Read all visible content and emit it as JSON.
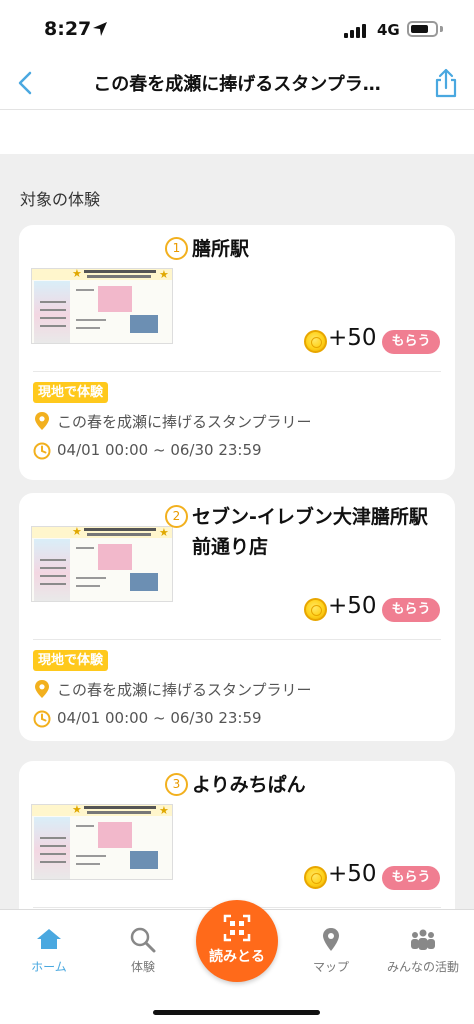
{
  "status_bar": {
    "time": "8:27",
    "network": "4G"
  },
  "nav": {
    "title": "この春を成瀬に捧げるスタンプラ…",
    "back_icon": "chevron-left-icon",
    "share_icon": "share-icon"
  },
  "section_label": "対象の体験",
  "cards": [
    {
      "number": "1",
      "title_lines": [
        "膳所駅"
      ],
      "points": "+50",
      "claim_label": "もらう",
      "tag": "現地で体験",
      "location": "この春を成瀬に捧げるスタンプラリー",
      "period": "04/01 00:00 ~ 06/30 23:59"
    },
    {
      "number": "2",
      "title_lines": [
        "セブン-イレブン大津膳所駅",
        "前通り店"
      ],
      "points": "+50",
      "claim_label": "もらう",
      "tag": "現地で体験",
      "location": "この春を成瀬に捧げるスタンプラリー",
      "period": "04/01 00:00 ~ 06/30 23:59"
    },
    {
      "number": "3",
      "title_lines": [
        "よりみちぱん"
      ],
      "points": "+50",
      "claim_label": "もらう"
    }
  ],
  "tab_bar": {
    "tabs": [
      {
        "label": "ホーム",
        "icon": "home-icon",
        "active": true
      },
      {
        "label": "体験",
        "icon": "search-icon",
        "active": false
      },
      {
        "label": "マップ",
        "icon": "map-pin-icon",
        "active": false
      },
      {
        "label": "みんなの活動",
        "icon": "people-icon",
        "active": false
      }
    ],
    "center_button": {
      "label": "読みとる",
      "icon": "qr-scan-icon"
    }
  },
  "colors": {
    "accent_blue": "#4aa8e0",
    "scan_orange": "#ff6a1a",
    "tag_yellow": "#ffc91c",
    "claim_pink": "#f07e91",
    "coin_gold": "#ffd21a"
  }
}
